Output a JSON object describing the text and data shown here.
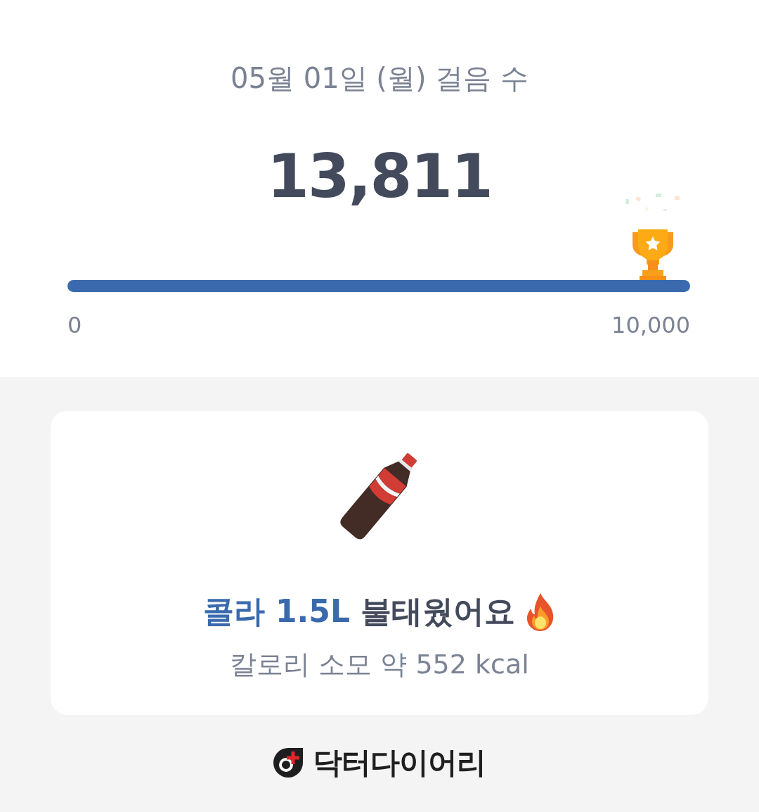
{
  "summary": {
    "title": "05월 01일 (월) 걸음 수",
    "steps": "13,811",
    "progress": {
      "level": 1,
      "min_label": "0",
      "max_label": "10,000"
    }
  },
  "card": {
    "highlight": "콜라 1.5L",
    "text": "불태웠어요",
    "detail": "칼로리 소모 약 552 kcal"
  },
  "footer": {
    "brand": "닥터다이어리"
  }
}
